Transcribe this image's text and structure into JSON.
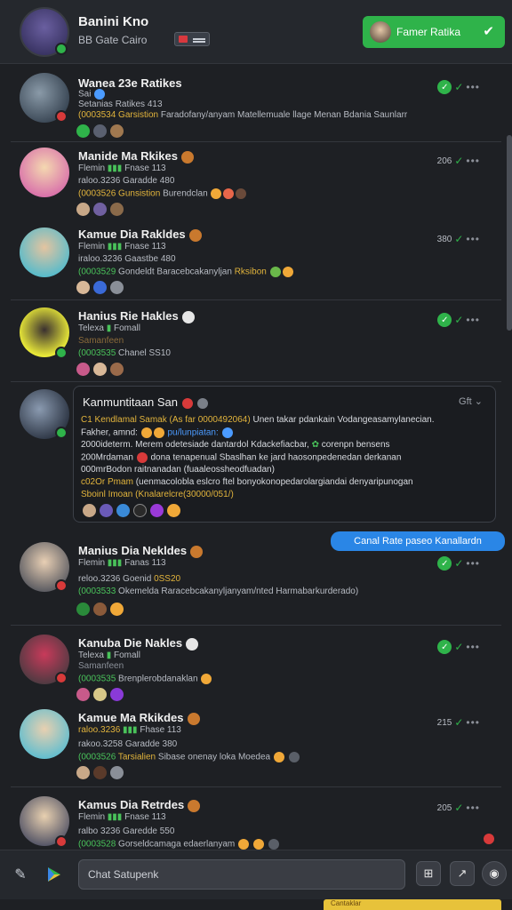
{
  "header": {
    "name": "Banini Kno",
    "sub": "BB Gate Cairo",
    "button_label": "Famer Ratika",
    "colors": {
      "accent_green": "#2fb34a",
      "badge_red": "#d83a3a",
      "link_blue": "#2a86e6"
    }
  },
  "rows": [
    {
      "name": "Wanea 23e Ratikes",
      "l1": "Sai",
      "l2": "Setanias Ratikes 413",
      "l3a": "(0003534",
      "l3b": "Garsistion",
      "l3c": "Faradofany/anyam Matellemuale llage Menan Bdania Saunlarr",
      "meta": ""
    },
    {
      "name": "Manide Ma Rkikes",
      "l1": "Flemin",
      "l2": "Fnase 113",
      "l3": "raloo.3236  Garadde 480",
      "l4a": "(0003526",
      "l4b": "Gunsistion",
      "l4c": "Burendclan",
      "meta": "206"
    },
    {
      "name": "Kamue Dia Rakldes",
      "l1": "Flemin",
      "l2": "Fnase 113",
      "l3": "iraloo.3236  Gaastbe 480",
      "l4a": "(0003529",
      "l4b": "Gondeldt",
      "l4c": "Baracebcakanyljan",
      "l4d": "Rksibon",
      "meta": "380"
    },
    {
      "name": "Hanius Rie Hakles",
      "l1": "Telexa",
      "l2": "Fomall",
      "l3": "Samanfeen",
      "l4a": "(0003535",
      "l4b": "Chanel SS10",
      "meta": ""
    },
    {
      "name": "Manius Dia Nekldes",
      "l1": "Flemin",
      "l2": "Fanas 113",
      "l3": "reloo.3236  Goenid",
      "l3b": "0SS20",
      "l4a": "(0003533",
      "l4b": "Okemelda Raracebcakanyljanyam/nted Harmabarkurderado)",
      "meta": ""
    },
    {
      "name": "Kanuba Die Nakles",
      "l1": "Telexa",
      "l2": "Fomall",
      "l3": "Samanfeen",
      "l4a": "(0003535",
      "l4b": "Brenplerobdanaklan",
      "meta": ""
    },
    {
      "name": "Kamue Ma Rkikdes",
      "l1": "raloo.3236",
      "l2": "Fhase 113",
      "l3": "rakoo.3258  Garadde 380",
      "l4a": "(0003526",
      "l4b": "Tarsialien",
      "l4c": "Sibase onenay loka Moedea",
      "meta": "215"
    },
    {
      "name": "Kamus Dia Retrdes",
      "l1": "Flemin",
      "l2": "Fnase 113",
      "l3": "ralbo 3236  Garedde 550",
      "l4a": "(0003528",
      "l4b": "Gorseldcamaga edaerlanyam",
      "meta": "205"
    }
  ],
  "card": {
    "title": "Kanmuntitaan San",
    "tr": "Gft",
    "l1a": "C1 Kendlamal Samak (As",
    "l1b": "far 0000492064)",
    "l1c": "Unen takar pdankain Vodangeasamylanecian.",
    "l2a": "Fakher, amnd:",
    "l2b": "pu/lunpiatan:",
    "l3a": "2000ideterm.",
    "l3b": "Merem odetesiade dantardol Kdackefiacbar,",
    "l3c": "corenpn bensens",
    "l4a": "200Mrdaman",
    "l4b": "dona tenapenual Sbaslhan ke jard haosonpedenedan derkanan",
    "l5": "000mrBodon raitnanadan (fuaaleossheodfuadan)",
    "l6a": "c02Or Pmam",
    "l6b": "(uenmacolobla eslcro ftel bonyokonopedarolargiandai denyaripunogan",
    "l7": "Sboinl Imoan (Knalarelcre(30000/051/)"
  },
  "pill": "Canal Rate paseo Kanallardn",
  "bottom": {
    "input_placeholder": "Chat Satupenk",
    "footer_text": "Cantaklar"
  }
}
